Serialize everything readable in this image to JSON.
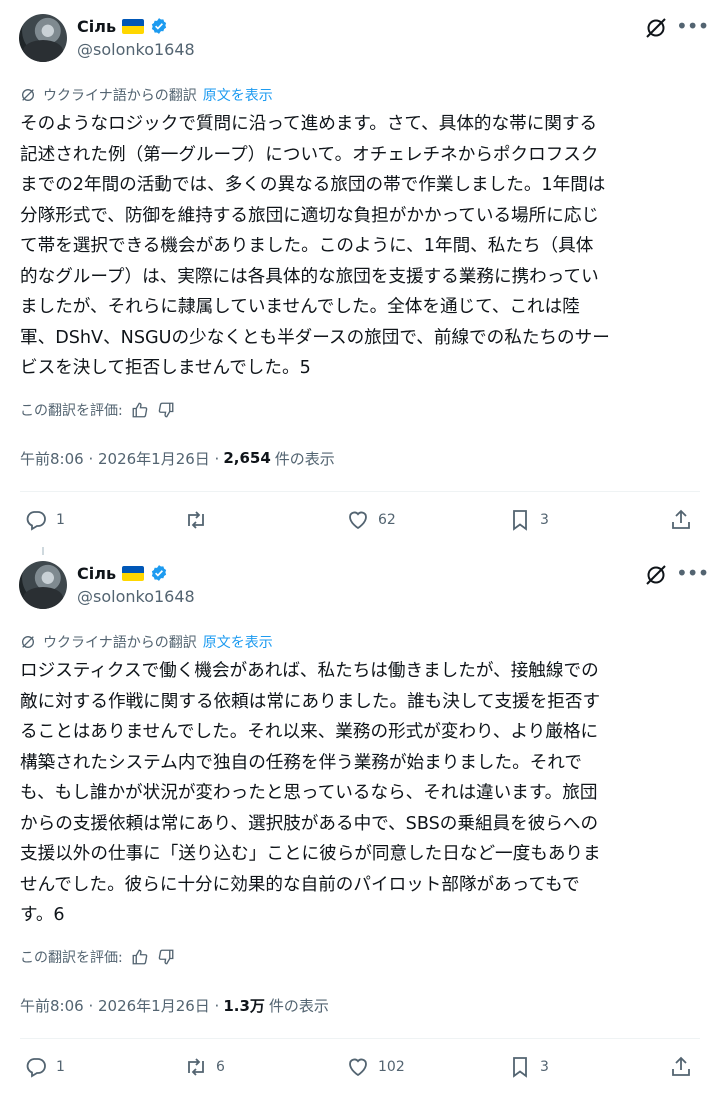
{
  "colors": {
    "accent": "#1d9bf0",
    "secondary_text": "#536471",
    "primary_text": "#0f1419"
  },
  "tweets": [
    {
      "author_name": "Сіль",
      "handle": "@solonko1648",
      "translated_label": "ウクライナ語からの翻訳",
      "show_original": "原文を表示",
      "body": "そのようなロジックで質問に沿って進めます。さて、具体的な帯に関する\n記述された例（第一グループ）について。オチェレチネからポクロフスク\nまでの2年間の活動では、多くの異なる旅団の帯で作業しました。1年間は\n分隊形式で、防御を維持する旅団に適切な負担がかかっている場所に応じ\nて帯を選択できる機会がありました。このように、1年間、私たち（具体\n的なグループ）は、実際には各具体的な旅団を支援する業務に携わってい\nましたが、それらに隷属していませんでした。全体を通じて、これは陸\n軍、DShV、NSGUの少なくとも半ダースの旅団で、前線での私たちのサー\nビスを決して拒否しませんでした。5",
      "rate_label": "この翻訳を評価:",
      "time": "午前8:06 · 2026年1月26日 ·",
      "views": "2,654",
      "views_label": "件の表示",
      "replies": "1",
      "reposts": "",
      "likes": "62",
      "bookmarks": "3"
    },
    {
      "author_name": "Сіль",
      "handle": "@solonko1648",
      "translated_label": "ウクライナ語からの翻訳",
      "show_original": "原文を表示",
      "body": "ロジスティクスで働く機会があれば、私たちは働きましたが、接触線での\n敵に対する作戦に関する依頼は常にありました。誰も決して支援を拒否す\nることはありませんでした。それ以来、業務の形式が変わり、より厳格に\n構築されたシステム内で独自の任務を伴う業務が始まりました。それで\nも、もし誰かが状況が変わったと思っているなら、それは違います。旅団\nからの支援依頼は常にあり、選択肢がある中で、SBSの乗組員を彼らへの\n支援以外の仕事に「送り込む」ことに彼らが同意した日など一度もありま\nせんでした。彼らに十分に効果的な自前のパイロット部隊があってもで\nす。6",
      "rate_label": "この翻訳を評価:",
      "time": "午前8:06 · 2026年1月26日 ·",
      "views": "1.3万",
      "views_label": "件の表示",
      "replies": "1",
      "reposts": "6",
      "likes": "102",
      "bookmarks": "3"
    }
  ]
}
